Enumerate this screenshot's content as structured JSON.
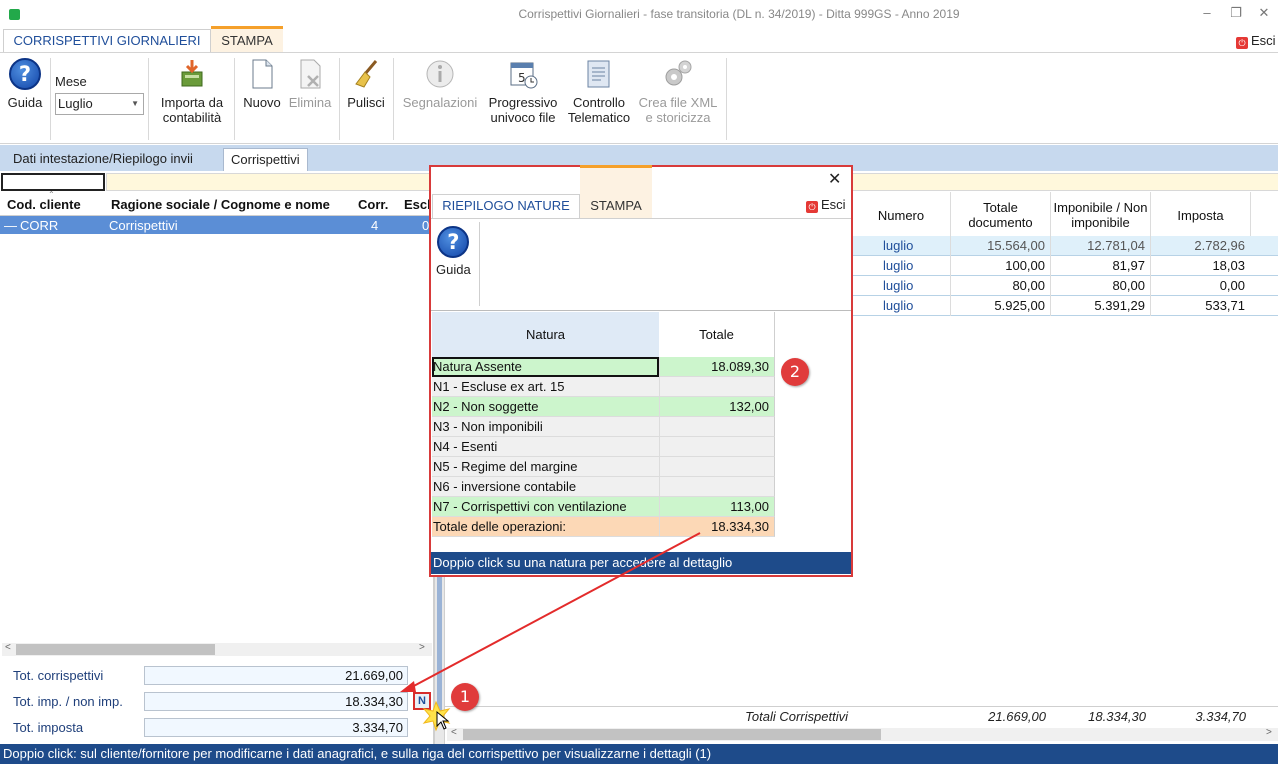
{
  "window": {
    "title": "Corrispettivi Giornalieri - fase transitoria (DL n. 34/2019) - Ditta 999GS - Anno 2019",
    "controls": {
      "minimize": "–",
      "restore": "❐",
      "close": "✕"
    }
  },
  "ribbon_tabs": [
    {
      "label": "CORRISPETTIVI GIORNALIERI",
      "active": true
    },
    {
      "label": "STAMPA",
      "active": false
    }
  ],
  "esci_label": "Esci",
  "ribbon": {
    "guida": "Guida",
    "mese_label": "Mese",
    "mese_value": "Luglio",
    "buttons": [
      {
        "label": "Importa da contabilità",
        "icon": "import-icon",
        "enabled": true
      },
      {
        "label": "Nuovo",
        "icon": "new-document-icon",
        "enabled": true
      },
      {
        "label": "Elimina",
        "icon": "delete-document-icon",
        "enabled": false
      },
      {
        "label": "Pulisci",
        "icon": "broom-icon",
        "enabled": true
      },
      {
        "label": "Segnalazioni",
        "icon": "info-icon",
        "enabled": false
      },
      {
        "label": "Progressivo univoco file",
        "icon": "calendar-clock-icon",
        "enabled": true
      },
      {
        "label": "Controllo Telematico",
        "icon": "check-document-icon",
        "enabled": true
      },
      {
        "label": "Crea file XML e storicizza",
        "icon": "gears-icon",
        "enabled": false
      }
    ]
  },
  "subtabs": [
    {
      "label": "Dati intestazione/Riepilogo invii",
      "active": false
    },
    {
      "label": "Corrispettivi",
      "active": true
    }
  ],
  "left_grid": {
    "columns": [
      "Cod. cliente",
      "Ragione sociale / Cognome e nome",
      "Corr.",
      "Escl"
    ],
    "rows": [
      {
        "cod": "CORR",
        "ragione": "Corrispettivi",
        "corr": "4",
        "escl": "0"
      }
    ]
  },
  "totals": {
    "corrispettivi_label": "Tot. corrispettivi",
    "corrispettivi_value": "21.669,00",
    "imp_label": "Tot. imp. / non imp.",
    "imp_value": "18.334,30",
    "imposta_label": "Tot. imposta",
    "imposta_value": "3.334,70",
    "n_button": "N"
  },
  "right_grid": {
    "columns": [
      "Numero",
      "Totale documento",
      "Imponibile / Non imponibile",
      "Imposta"
    ],
    "rows": [
      {
        "numero": "luglio",
        "totale": "15.564,00",
        "imponibile": "12.781,04",
        "imposta": "2.782,96"
      },
      {
        "numero": "luglio",
        "totale": "100,00",
        "imponibile": "81,97",
        "imposta": "18,03"
      },
      {
        "numero": "luglio",
        "totale": "80,00",
        "imponibile": "80,00",
        "imposta": "0,00"
      },
      {
        "numero": "luglio",
        "totale": "5.925,00",
        "imponibile": "5.391,29",
        "imposta": "533,71"
      }
    ],
    "totals_label": "Totali  Corrispettivi",
    "totals": {
      "totale": "21.669,00",
      "imponibile": "18.334,30",
      "imposta": "3.334,70"
    }
  },
  "popup": {
    "tabs": [
      "RIEPILOGO NATURE",
      "STAMPA"
    ],
    "close": "✕",
    "esci": "Esci",
    "guida": "Guida",
    "columns": [
      "Natura",
      "Totale"
    ],
    "rows": [
      {
        "natura": "Natura Assente",
        "totale": "18.089,30"
      },
      {
        "natura": "N1 - Escluse ex art. 15",
        "totale": ""
      },
      {
        "natura": "N2 - Non soggette",
        "totale": "132,00"
      },
      {
        "natura": "N3 - Non imponibili",
        "totale": ""
      },
      {
        "natura": "N4 - Esenti",
        "totale": ""
      },
      {
        "natura": "N5 - Regime del margine",
        "totale": ""
      },
      {
        "natura": "N6 - inversione contabile",
        "totale": ""
      },
      {
        "natura": "N7 - Corrispettivi con ventilazione",
        "totale": "113,00"
      }
    ],
    "total_row": {
      "natura": "Totale delle operazioni:",
      "totale": "18.334,30"
    },
    "footer": "Doppio click su una natura per accedere al dettaglio"
  },
  "callouts": [
    "1",
    "2"
  ],
  "status_bar": "Doppio click: sul cliente/fornitore per modificarne i dati anagrafici, e sulla riga del corrispettivo per visualizzarne i dettagli (1)",
  "colors": {
    "accent_blue": "#1e4b8a",
    "highlight_row": "#5b8ed6",
    "callout_red": "#e03b3b",
    "natura_green": "#ccf5cc",
    "total_orange": "#fcd8b6"
  }
}
